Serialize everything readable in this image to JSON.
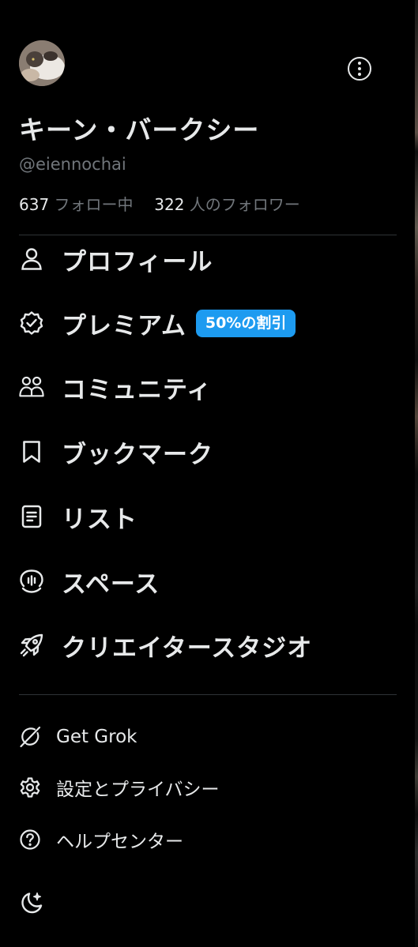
{
  "profile": {
    "display_name": "キーン・バークシー",
    "handle": "@eiennochai",
    "following_count": "637",
    "following_label": "フォロー中",
    "followers_count": "322",
    "followers_label": "人のフォロワー"
  },
  "menu": {
    "items": [
      {
        "label": "プロフィール",
        "icon": "person-icon"
      },
      {
        "label": "プレミアム",
        "icon": "verified-badge-icon",
        "badge": "50%の割引"
      },
      {
        "label": "コミュニティ",
        "icon": "communities-icon"
      },
      {
        "label": "ブックマーク",
        "icon": "bookmark-icon"
      },
      {
        "label": "リスト",
        "icon": "list-icon"
      },
      {
        "label": "スペース",
        "icon": "spaces-icon"
      },
      {
        "label": "クリエイタースタジオ",
        "icon": "rocket-icon"
      }
    ]
  },
  "secondary": {
    "items": [
      {
        "label": "Get Grok",
        "icon": "grok-icon"
      },
      {
        "label": "設定とプライバシー",
        "icon": "gear-icon"
      },
      {
        "label": "ヘルプセンター",
        "icon": "help-icon"
      }
    ]
  },
  "theme_toggle": {
    "icon": "moon-sparkle-icon"
  },
  "colors": {
    "background": "#000000",
    "text": "#e7e9ea",
    "muted": "#71767b",
    "divider": "#2f3336",
    "accent": "#1d9bf0"
  }
}
